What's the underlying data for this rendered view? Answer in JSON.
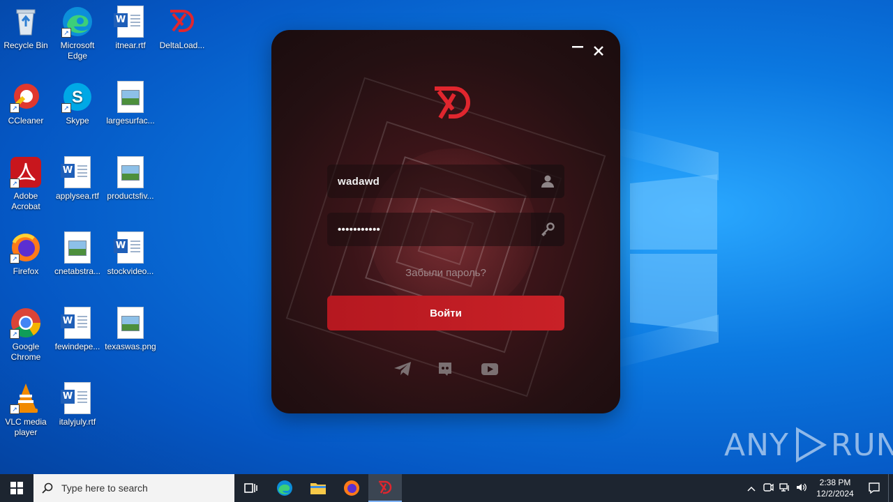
{
  "desktop": {
    "icons": [
      {
        "label": "Recycle Bin",
        "icon": "recycle-bin-icon"
      },
      {
        "label": "Microsoft Edge",
        "icon": "edge-icon"
      },
      {
        "label": "itnear.rtf",
        "icon": "word-document-icon"
      },
      {
        "label": "DeltaLoad...",
        "icon": "deltaload-icon"
      },
      {
        "label": "CCleaner",
        "icon": "ccleaner-icon"
      },
      {
        "label": "Skype",
        "icon": "skype-icon"
      },
      {
        "label": "largesurfac...",
        "icon": "image-file-icon"
      },
      {
        "label": "Adobe Acrobat",
        "icon": "acrobat-icon"
      },
      {
        "label": "applysea.rtf",
        "icon": "word-document-icon"
      },
      {
        "label": "productsfiv...",
        "icon": "image-file-icon"
      },
      {
        "label": "Firefox",
        "icon": "firefox-icon"
      },
      {
        "label": "cnetabstra...",
        "icon": "image-file-icon"
      },
      {
        "label": "stockvideo...",
        "icon": "word-document-icon"
      },
      {
        "label": "Google Chrome",
        "icon": "chrome-icon"
      },
      {
        "label": "fewindepe...",
        "icon": "word-document-icon"
      },
      {
        "label": "texaswas.png",
        "icon": "image-file-icon"
      },
      {
        "label": "VLC media player",
        "icon": "vlc-icon"
      },
      {
        "label": "italyjuly.rtf",
        "icon": "word-document-icon"
      }
    ]
  },
  "app": {
    "username": "wadawd",
    "password_masked": "•••••••••••",
    "forgot_label": "Забыли пароль?",
    "login_label": "Войти",
    "minimize_glyph": "—",
    "close_glyph": "✕",
    "brand_color": "#c92127"
  },
  "watermark": {
    "text_left": "ANY",
    "text_right": "RUN"
  },
  "taskbar": {
    "search_placeholder": "Type here to search",
    "time": "2:38 PM",
    "date": "12/2/2024"
  }
}
